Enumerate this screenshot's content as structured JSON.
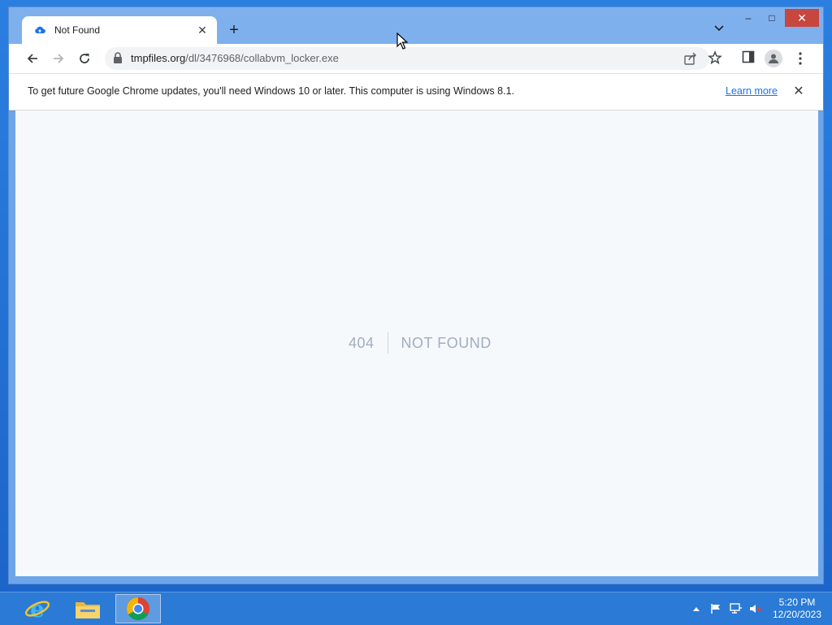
{
  "tab": {
    "title": "Not Found",
    "close_label": "✕"
  },
  "newtab_label": "+",
  "window_controls": {
    "minimize": "–",
    "maximize": "□",
    "close": "✕"
  },
  "url": {
    "host": "tmpfiles.org",
    "path": "/dl/3476968/collabvm_locker.exe"
  },
  "infobar": {
    "message": "To get future Google Chrome updates, you'll need Windows 10 or later. This computer is using Windows 8.1.",
    "link": "Learn more",
    "close": "✕"
  },
  "page": {
    "code": "404",
    "message": "NOT FOUND"
  },
  "clock": {
    "time": "5:20 PM",
    "date": "12/20/2023"
  },
  "colors": {
    "accent": "#1a73e8",
    "close_button": "#c7463d",
    "taskbar": "#2a7ad6",
    "page_bg": "#f6f9fc",
    "notfound_text": "#a0aec0"
  },
  "icons": {
    "tab_favicon": "cloud-upload-icon",
    "back": "back-arrow-icon",
    "forward": "forward-arrow-icon",
    "reload": "reload-icon",
    "lock": "lock-icon",
    "share": "share-icon",
    "bookmark": "star-icon",
    "side_panel": "side-panel-icon",
    "profile": "profile-icon",
    "menu": "kebab-menu-icon"
  },
  "taskbar": {
    "apps": [
      "internet-explorer-icon",
      "file-explorer-icon",
      "chrome-icon"
    ],
    "active_app": "chrome-icon"
  }
}
